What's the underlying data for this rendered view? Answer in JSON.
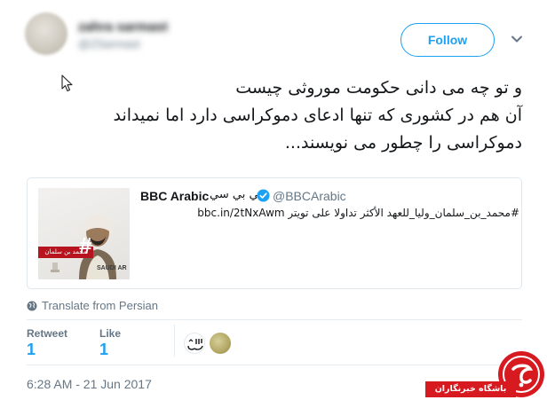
{
  "author": {
    "name": "zahra sarmast",
    "handle": "@ZSarmast"
  },
  "header": {
    "follow_label": "Follow",
    "caret_icon": "chevron-down-icon"
  },
  "tweet": {
    "lines": [
      "و تو چه می دانی حکومت موروثی چیست",
      "آن هم در کشوری که تنها ادعای دموکراسی دارد اما نمیداند",
      "دموکراسی را چطور می نویسند..."
    ]
  },
  "quoted": {
    "name": "BBC Arabic",
    "name_ar": "بي بي سي",
    "verified_icon": "verified-badge-icon",
    "handle": "@BBCArabic",
    "text": "#محمد_بن_سلمان_وليا_للعهد الأكثر تداولا على تويتر bbc.in/2tNxAwm",
    "media": {
      "strip_text": "محمد بن سلمان",
      "hash": "#",
      "caption": "SAUDI AR"
    }
  },
  "translate": {
    "label": "Translate from Persian",
    "icon": "globe-icon"
  },
  "stats": {
    "retweet_label": "Retweet",
    "retweet_count": "1",
    "like_label": "Like",
    "like_count": "1"
  },
  "timestamp": "6:28 AM - 21 Jun 2017",
  "watermark": {
    "banner_text": "باشگاه خبرنگاران",
    "logo_letter": "ج"
  },
  "colors": {
    "accent": "#1da1f2",
    "muted": "#657786",
    "brand_red": "#d71920"
  }
}
